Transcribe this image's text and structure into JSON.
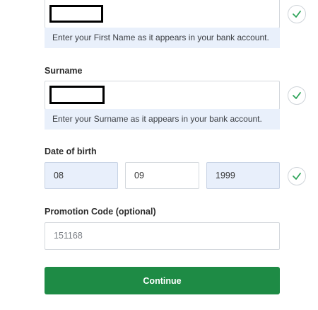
{
  "first_name": {
    "value": "",
    "hint": "Enter your First Name as it appears in your bank account."
  },
  "surname": {
    "label": "Surname",
    "value": "",
    "hint": "Enter your Surname as it appears in your bank account."
  },
  "date_of_birth": {
    "label": "Date of birth",
    "day": "08",
    "month": "09",
    "year": "1999"
  },
  "promotion": {
    "label": "Promotion Code (optional)",
    "value": "151168"
  },
  "continue_label": "Continue",
  "icons": {
    "valid": "check-circle-icon"
  },
  "colors": {
    "accent_green": "#1e8b45",
    "hint_background": "#e9f0fb",
    "check_mark": "#2fa55a"
  }
}
